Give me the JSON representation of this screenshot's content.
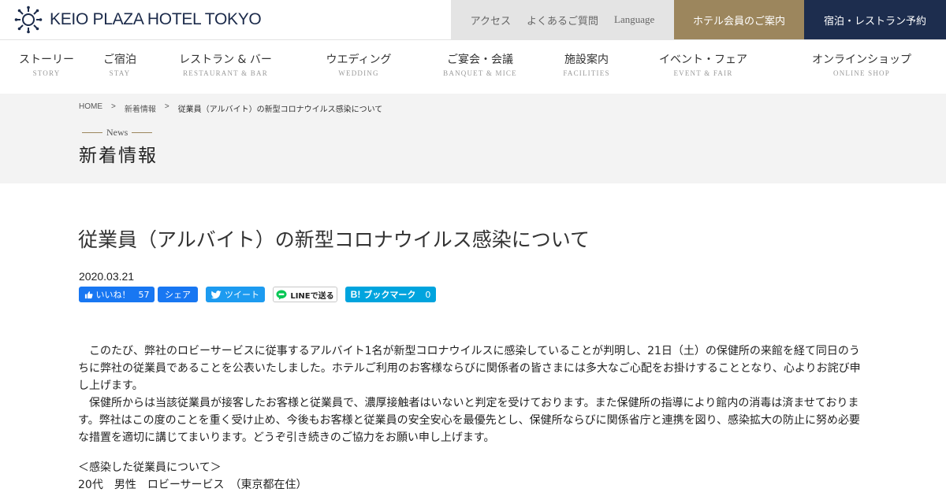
{
  "brand": {
    "name": "KEIO PLAZA HOTEL TOKYO",
    "navy": "#1d2d4e",
    "gold": "#9c865d"
  },
  "utility_nav": [
    "アクセス",
    "よくあるご質問",
    "Language"
  ],
  "member_button": "ホテル会員のご案内",
  "reserve_button": "宿泊・レストラン予約",
  "global_nav": [
    {
      "jp": "ストーリー",
      "en": "STORY"
    },
    {
      "jp": "ご宿泊",
      "en": "STAY"
    },
    {
      "jp": "レストラン & バー",
      "en": "RESTAURANT & BAR"
    },
    {
      "jp": "ウエディング",
      "en": "WEDDING"
    },
    {
      "jp": "ご宴会・会議",
      "en": "BANQUET & MICE"
    },
    {
      "jp": "施設案内",
      "en": "FACILITIES"
    },
    {
      "jp": "イベント・フェア",
      "en": "EVENT & FAIR"
    },
    {
      "jp": "オンラインショップ",
      "en": "ONLINE SHOP"
    }
  ],
  "breadcrumb": {
    "items": [
      "HOME",
      "新着情報",
      "従業員（アルバイト）の新型コロナウイルス感染について"
    ],
    "separator": ">"
  },
  "section": {
    "eyebrow": "News",
    "title": "新着情報"
  },
  "article": {
    "title": "従業員（アルバイト）の新型コロナウイルス感染について",
    "date": "2020.03.21",
    "paragraphs": [
      "　このたび、弊社のロビーサービスに従事するアルバイト1名が新型コロナウイルスに感染していることが判明し、21日（土）の保健所の来館を経て同日のうちに弊社の従業員であることを公表いたしました。ホテルご利用のお客様ならびに関係者の皆さまには多大なご心配をお掛けすることとなり、心よりお詫び申し上げます。",
      "　保健所からは当該従業員が接客したお客様と従業員で、濃厚接触者はいないと判定を受けております。また保健所の指導により館内の消毒は済ませております。弊社はこの度のことを重く受け止め、今後もお客様と従業員の安全安心を最優先とし、保健所ならびに関係省庁と連携を図り、感染拡大の防止に努め必要な措置を適切に講じてまいります。どうぞ引き続きのご協力をお願い申し上げます。"
    ],
    "infected_heading": "＜感染した従業員について＞",
    "infected_detail": "20代　男性　ロビーサービス　（東京都在住）"
  },
  "share": {
    "fb_like_label": "いいね！",
    "fb_like_count": "57",
    "fb_share_label": "シェア",
    "tweet_label": "ツイート",
    "line_label": "LINEで送る",
    "hatena_label": "ブックマーク",
    "hatena_count": "0",
    "colors": {
      "facebook": "#1877f2",
      "twitter": "#1d9bf0",
      "line": "#06c755",
      "hatena": "#00a4de"
    }
  }
}
